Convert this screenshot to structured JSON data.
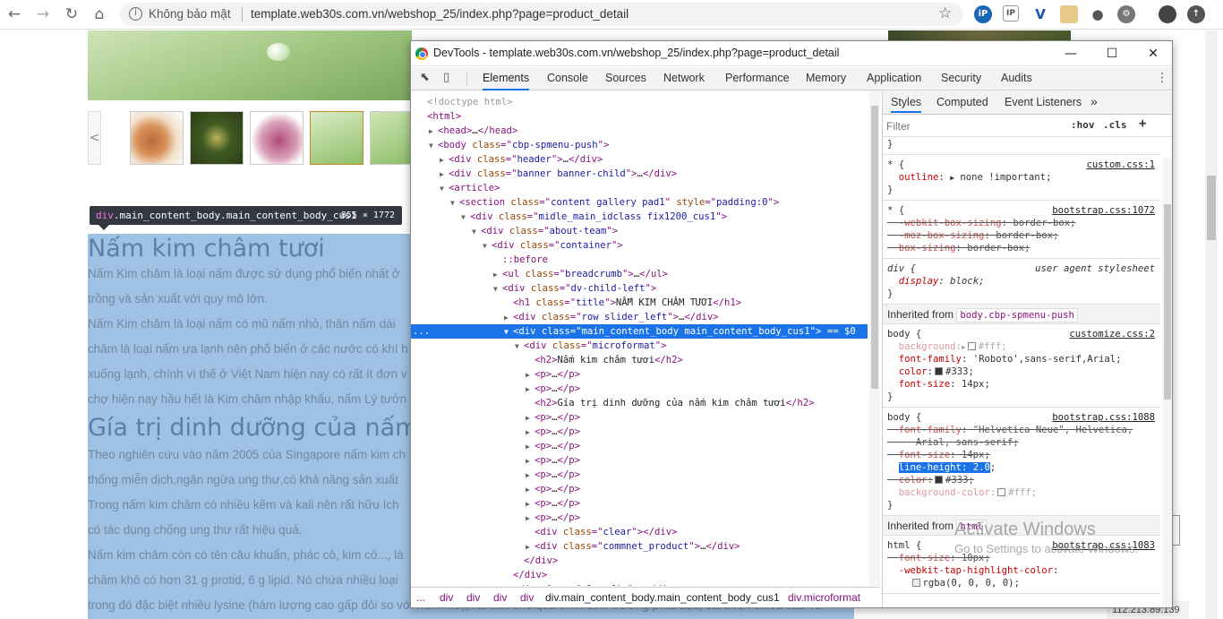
{
  "browser": {
    "security_text": "Không bảo mật",
    "url": "template.web30s.com.vn/webshop_25/index.php?page=product_detail",
    "extensions": [
      "ip",
      "IP",
      "V",
      "emoji",
      "pin",
      "gear",
      "user",
      "update"
    ]
  },
  "page": {
    "tooltip_selector": "div.main_content_body.main_content_body_cus1",
    "tooltip_tag": "div",
    "tooltip_dims": "855 × 1772",
    "title1": "Nấm kim châm tươi",
    "title2": "Gía trị dinh dưỡng của nấm",
    "lines": [
      "Nấm Kim châm là loại nấm được sử dụng phổ biến nhất ở",
      "trồng và sản xuất với quy mô lớn.",
      "Nấm Kim châm là loại nấm có mũ nấm nhỏ, thân nấm dài",
      "châm là loại nấm ưa lạnh nên phổ biến ở các nước có khí h",
      "xuống lạnh, chính vì thế ở Việt Nam hiện nay có rất ít đơn v",
      "chợ hiện nay hầu hết là Kim châm nhập khẩu, nấm Lý tưởn",
      "Theo nghiên cứu vào năm 2005 của Singapore nấm kim ch",
      "thống miễn dịch,ngăn ngừa ung thư,có khả năng sản xuất",
      "Trong nấm kim châm có nhiều kẽm và kali nên rất hữu ích",
      "có tác dụng chống ung thư rất hiệu quả.",
      "Nấm kim châm còn có tên câu khuẩn, phác cô, kim cô..., là",
      "châm khô có hơn 31 g protid, 6 g lipid. Nó chứa nhiều loại",
      "trong đó đặc biệt nhiều lysine (hàm lượng cao gấp đôi so với nấm mỡ), rất cần cho quá trình sinh trưởng phát dục, cải thiện chiều cao và"
    ],
    "bottom_tail": "ới nấm mỡ), rất cần cho quá trình sinh trưởng phát dục, cải thiện chiều cao và",
    "ip_badge": "112.213.89.139",
    "thumb_prev": "<",
    "watermark_title": "Activate Windows",
    "watermark_sub": "Go to Settings to activate Windows."
  },
  "devtools": {
    "window_title": "DevTools - template.web30s.com.vn/webshop_25/index.php?page=product_detail",
    "tabs": [
      "Elements",
      "Console",
      "Sources",
      "Network",
      "Performance",
      "Memory",
      "Application",
      "Security",
      "Audits"
    ],
    "active_tab": "Elements",
    "styles_tabs": [
      "Styles",
      "Computed",
      "Event Listeners"
    ],
    "filter_placeholder": "Filter",
    "hov": ":hov",
    "cls": ".cls",
    "breadcrumbs": [
      "...",
      "div",
      "div",
      "div",
      "div",
      "div.main_content_body.main_content_body_cus1",
      "div.microformat"
    ],
    "dom_lines": [
      {
        "indent": 0,
        "tri": "",
        "html": "<span class='cm'>&lt;!doctype html&gt;</span>"
      },
      {
        "indent": 0,
        "tri": "",
        "html": "<span class='t'>&lt;html&gt;</span>"
      },
      {
        "indent": 1,
        "tri": "▶",
        "html": "<span class='t'>&lt;head&gt;</span><span class='tx'>…</span><span class='t'>&lt;/head&gt;</span>"
      },
      {
        "indent": 1,
        "tri": "▼",
        "html": "<span class='t'>&lt;body </span><span class='an'>class</span><span class='t'>=\"</span><span class='av'>cbp-spmenu-push</span><span class='t'>\"&gt;</span>"
      },
      {
        "indent": 2,
        "tri": "▶",
        "html": "<span class='t'>&lt;div </span><span class='an'>class</span><span class='t'>=\"</span><span class='av'>header</span><span class='t'>\"&gt;</span><span class='tx'>…</span><span class='t'>&lt;/div&gt;</span>"
      },
      {
        "indent": 2,
        "tri": "▶",
        "html": "<span class='t'>&lt;div </span><span class='an'>class</span><span class='t'>=\"</span><span class='av'>banner banner-child</span><span class='t'>\"&gt;</span><span class='tx'>…</span><span class='t'>&lt;/div&gt;</span>"
      },
      {
        "indent": 2,
        "tri": "▼",
        "html": "<span class='t'>&lt;article&gt;</span>"
      },
      {
        "indent": 3,
        "tri": "▼",
        "html": "<span class='t'>&lt;section </span><span class='an'>class</span><span class='t'>=\"</span><span class='av'>content gallery pad1</span><span class='t'>\" </span><span class='an'>style</span><span class='t'>=\"</span><span class='av'>padding:0</span><span class='t'>\"&gt;</span>"
      },
      {
        "indent": 4,
        "tri": "▼",
        "html": "<span class='t'>&lt;div </span><span class='an'>class</span><span class='t'>=\"</span><span class='av'>midle_main_idclass fix1200_cus1</span><span class='t'>\"&gt;</span>"
      },
      {
        "indent": 5,
        "tri": "▼",
        "html": "<span class='t'>&lt;div </span><span class='an'>class</span><span class='t'>=\"</span><span class='av'>about-team</span><span class='t'>\"&gt;</span>"
      },
      {
        "indent": 6,
        "tri": "▼",
        "html": "<span class='t'>&lt;div </span><span class='an'>class</span><span class='t'>=\"</span><span class='av'>container</span><span class='t'>\"&gt;</span>"
      },
      {
        "indent": 7,
        "tri": "",
        "html": "<span class='t'>::before</span>"
      },
      {
        "indent": 7,
        "tri": "▶",
        "html": "<span class='t'>&lt;ul </span><span class='an'>class</span><span class='t'>=\"</span><span class='av'>breadcrumb</span><span class='t'>\"&gt;</span><span class='tx'>…</span><span class='t'>&lt;/ul&gt;</span>"
      },
      {
        "indent": 7,
        "tri": "▼",
        "html": "<span class='t'>&lt;div </span><span class='an'>class</span><span class='t'>=\"</span><span class='av'>dv-child-left</span><span class='t'>\"&gt;</span>"
      },
      {
        "indent": 8,
        "tri": "",
        "html": "<span class='t'>&lt;h1 </span><span class='an'>class</span><span class='t'>=\"</span><span class='av'>title</span><span class='t'>\"&gt;</span><span class='tx'>NẤM KIM CHÂM TƯƠI</span><span class='t'>&lt;/h1&gt;</span>"
      },
      {
        "indent": 8,
        "tri": "▶",
        "html": "<span class='t'>&lt;div </span><span class='an'>class</span><span class='t'>=\"</span><span class='av'>row slider_left</span><span class='t'>\"&gt;</span><span class='tx'>…</span><span class='t'>&lt;/div&gt;</span>"
      },
      {
        "indent": 8,
        "tri": "▼",
        "sel": true,
        "html": "<span class='t'>&lt;div </span><span class='an'>class</span><span class='t'>=\"</span><span class='av'>main_content_body main_content_body_cus1</span><span class='t'>\"&gt;</span><span class='tx'> == $0</span>"
      },
      {
        "indent": 9,
        "tri": "▼",
        "html": "<span class='t'>&lt;div </span><span class='an'>class</span><span class='t'>=\"</span><span class='av'>microformat</span><span class='t'>\"&gt;</span>"
      },
      {
        "indent": 10,
        "tri": "",
        "html": "<span class='t'>&lt;h2&gt;</span><span class='tx'>Nấm kim châm tươi</span><span class='t'>&lt;/h2&gt;</span>"
      },
      {
        "indent": 10,
        "tri": "▶",
        "html": "<span class='t'>&lt;p&gt;</span><span class='tx'>…</span><span class='t'>&lt;/p&gt;</span>"
      },
      {
        "indent": 10,
        "tri": "▶",
        "html": "<span class='t'>&lt;p&gt;</span><span class='tx'>…</span><span class='t'>&lt;/p&gt;</span>"
      },
      {
        "indent": 10,
        "tri": "",
        "html": "<span class='t'>&lt;h2&gt;</span><span class='tx'>Gía trị dinh dưỡng của nấm kim châm tươi</span><span class='t'>&lt;/h2&gt;</span>"
      },
      {
        "indent": 10,
        "tri": "▶",
        "html": "<span class='t'>&lt;p&gt;</span><span class='tx'>…</span><span class='t'>&lt;/p&gt;</span>"
      },
      {
        "indent": 10,
        "tri": "▶",
        "html": "<span class='t'>&lt;p&gt;</span><span class='tx'>…</span><span class='t'>&lt;/p&gt;</span>"
      },
      {
        "indent": 10,
        "tri": "▶",
        "html": "<span class='t'>&lt;p&gt;</span><span class='tx'>…</span><span class='t'>&lt;/p&gt;</span>"
      },
      {
        "indent": 10,
        "tri": "▶",
        "html": "<span class='t'>&lt;p&gt;</span><span class='tx'>…</span><span class='t'>&lt;/p&gt;</span>"
      },
      {
        "indent": 10,
        "tri": "▶",
        "html": "<span class='t'>&lt;p&gt;</span><span class='tx'>…</span><span class='t'>&lt;/p&gt;</span>"
      },
      {
        "indent": 10,
        "tri": "▶",
        "html": "<span class='t'>&lt;p&gt;</span><span class='tx'>…</span><span class='t'>&lt;/p&gt;</span>"
      },
      {
        "indent": 10,
        "tri": "▶",
        "html": "<span class='t'>&lt;p&gt;</span><span class='tx'>…</span><span class='t'>&lt;/p&gt;</span>"
      },
      {
        "indent": 10,
        "tri": "▶",
        "html": "<span class='t'>&lt;p&gt;</span><span class='tx'>…</span><span class='t'>&lt;/p&gt;</span>"
      },
      {
        "indent": 10,
        "tri": "",
        "html": "<span class='t'>&lt;div </span><span class='an'>class</span><span class='t'>=\"</span><span class='av'>clear</span><span class='t'>\"&gt;&lt;/div&gt;</span>"
      },
      {
        "indent": 10,
        "tri": "▶",
        "html": "<span class='t'>&lt;div </span><span class='an'>class</span><span class='t'>=\"</span><span class='av'>commnet_product</span><span class='t'>\"&gt;</span><span class='tx'>…</span><span class='t'>&lt;/div&gt;</span>"
      },
      {
        "indent": 9,
        "tri": "",
        "html": "<span class='t'>&lt;/div&gt;</span>"
      },
      {
        "indent": 8,
        "tri": "",
        "html": "<span class='t'>&lt;/div&gt;</span>"
      },
      {
        "indent": 8,
        "tri": "▶",
        "html": "<span class='t'>&lt;div </span><span class='an'>class</span><span class='t'>=\"</span><span class='av'>clearfix</span><span class='t'>\"&gt;</span><span class='tx'>…</span><span class='t'>&lt;/div&gt;</span>"
      }
    ]
  }
}
